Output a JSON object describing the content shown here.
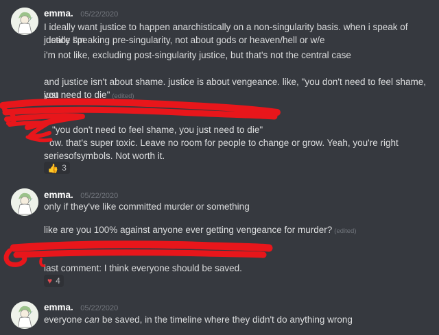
{
  "messages": [
    {
      "author": "emma.",
      "timestamp": "05/22/2020",
      "lines": [
        "I ideally want justice to happen anarchistically on a non-singularity basis. when i speak of justice I'm",
        "ideally speaking pre-singularity, not about gods or heaven/hell or w/e",
        "i'm not like, excluding post-singularity justice, but that's not the central case",
        "and justice isn't about shame. justice is about vengeance. like, \"you don't need to feel shame, you",
        "just need to die\""
      ],
      "edited_label": "(edited)"
    },
    {
      "lines": [
        "\"you don't need to feel shame, you just need to die\"",
        "ow. that's super toxic. Leave no room for people to change or grow. Yeah, you're right",
        "seriesofsymbols. Not worth it."
      ],
      "reaction": {
        "icon": "thumbs-up-icon",
        "count": "3"
      }
    },
    {
      "author": "emma.",
      "timestamp": "05/22/2020",
      "lines": [
        "only if they've like committed murder or something",
        "like are you 100% against anyone ever getting vengeance for murder?"
      ],
      "edited_label": "(edited)"
    },
    {
      "lines": [
        "last comment: I think everyone should be saved."
      ],
      "reaction": {
        "icon": "heart-icon",
        "count": "4"
      }
    },
    {
      "author": "emma.",
      "timestamp": "05/22/2020",
      "line_before": "everyone ",
      "line_emphasis": "can",
      "line_after": " be saved, in the timeline where they didn't do anything wrong"
    }
  ],
  "colors": {
    "background": "#36393f",
    "text": "#dcddde",
    "author": "#ffffff",
    "muted": "#72767d",
    "redaction": "#e8161b"
  }
}
